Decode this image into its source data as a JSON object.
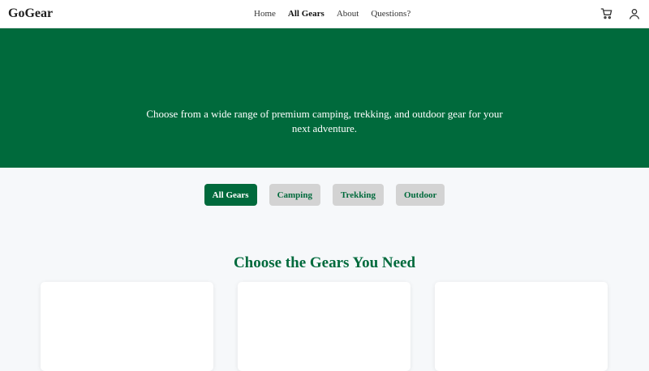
{
  "navbar": {
    "brand": "GoGear",
    "links": [
      {
        "label": "Home",
        "active": false
      },
      {
        "label": "All Gears",
        "active": true
      },
      {
        "label": "About",
        "active": false
      },
      {
        "label": "Questions?",
        "active": false
      }
    ],
    "icons": [
      "cart-icon",
      "user-icon"
    ]
  },
  "hero": {
    "text": "Choose from a wide range of premium camping, trekking, and outdoor gear for your next adventure."
  },
  "filters": [
    {
      "label": "All Gears",
      "active": true
    },
    {
      "label": "Camping",
      "active": false
    },
    {
      "label": "Trekking",
      "active": false
    },
    {
      "label": "Outdoor",
      "active": false
    }
  ],
  "section": {
    "title": "Choose the Gears You Need"
  },
  "colors": {
    "brand_green": "#006a3c",
    "inactive_button": "#d3d3d3",
    "page_background": "#f6f8fa"
  }
}
